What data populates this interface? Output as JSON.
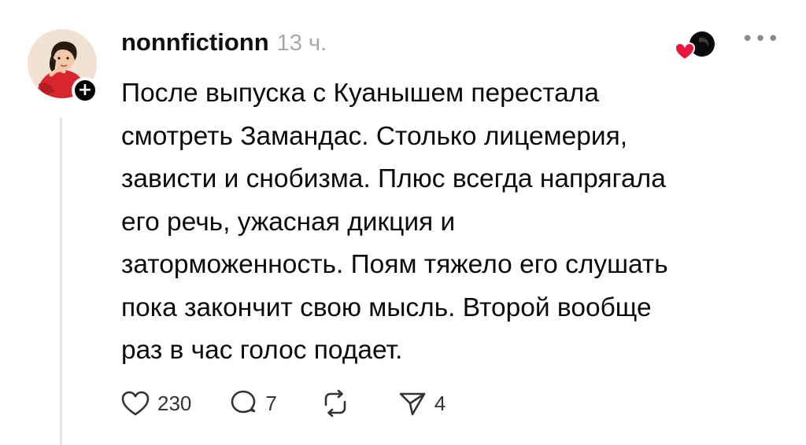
{
  "post": {
    "username": "nonnfictionn",
    "time": "13 ч.",
    "text": "После выпуска с Куанышем перестала\nсмотреть Замандас. Столько лицемерия,\nзависти и снобизма. Плюс всегда напрягала\nего речь, ужасная дикция и\nзаторможенность. Поям тяжело его слушать\nпока закончит свою мысль. Второй вообще\nраз в час голос подает.",
    "follow_badge": "+",
    "more_label": "•••"
  },
  "actions": {
    "likes": "230",
    "replies": "7",
    "shares": "4"
  },
  "icons": {
    "like": "heart-outline-icon",
    "reply": "speech-bubble-icon",
    "repost": "repost-arrows-icon",
    "share": "paper-plane-icon",
    "more": "ellipsis-icon",
    "liked_by": "heart-with-avatar-icon"
  },
  "colors": {
    "heart_red": "#e8173e",
    "time_gray": "#a8a8a8",
    "thread_line": "#e4e4e4"
  }
}
